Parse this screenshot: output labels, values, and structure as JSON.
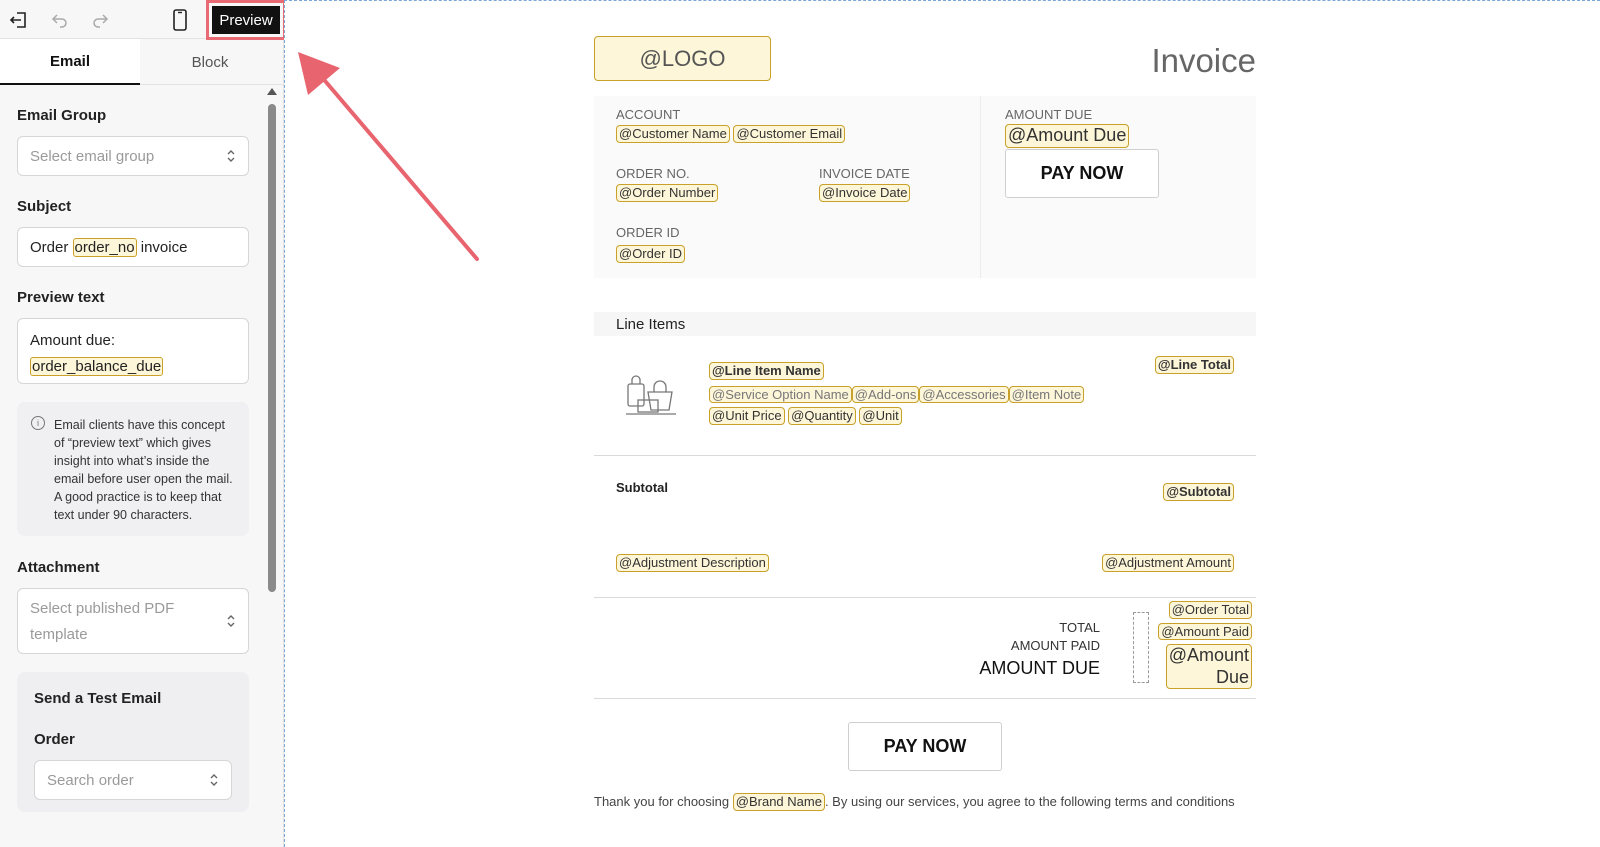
{
  "toolbar": {
    "preview_label": "Preview"
  },
  "tabs": [
    {
      "label": "Email",
      "active": true
    },
    {
      "label": "Block",
      "active": false
    }
  ],
  "panel": {
    "email_group": {
      "label": "Email Group",
      "placeholder": "Select email group"
    },
    "subject": {
      "label": "Subject",
      "prefix": "Order",
      "tag": "order_no",
      "suffix": "invoice"
    },
    "preview_text": {
      "label": "Preview text",
      "prefix": "Amount due:",
      "tag": "order_balance_due"
    },
    "info": "Email clients have this concept of “preview text” which gives insight into what’s inside the email before user open the mail. A good practice is to keep that text under 90 characters.",
    "attachment": {
      "label": "Attachment",
      "placeholder_line1": "Select published PDF",
      "placeholder_line2": "template"
    },
    "test_email": {
      "title": "Send a Test Email",
      "order_label": "Order",
      "order_placeholder": "Search order"
    }
  },
  "invoice": {
    "logo": "@LOGO",
    "title": "Invoice",
    "account": {
      "caption": "ACCOUNT",
      "name": "@Customer Name",
      "email": "@Customer Email"
    },
    "amount_due": {
      "caption": "AMOUNT DUE",
      "value": "@Amount Due"
    },
    "pay_now_top": "PAY NOW",
    "order_no": {
      "caption": "ORDER NO.",
      "value": "@Order Number"
    },
    "invoice_date": {
      "caption": "INVOICE DATE",
      "value": "@Invoice Date"
    },
    "order_id": {
      "caption": "ORDER ID",
      "value": "@Order ID"
    },
    "line_items": {
      "heading": "Line Items",
      "name": "@Line Item Name",
      "service_option": "@Service Option Name",
      "addons": "@Add-ons",
      "accessories": "@Accessories",
      "item_note": "@Item Note",
      "unit_price": "@Unit Price",
      "quantity": "@Quantity",
      "unit": "@Unit",
      "line_total": "@Line Total"
    },
    "subtotal": {
      "label": "Subtotal",
      "value": "@Subtotal"
    },
    "adjustment": {
      "description": "@Adjustment Description",
      "amount": "@Adjustment Amount"
    },
    "totals": {
      "total_label": "TOTAL",
      "amount_paid_label": "AMOUNT PAID",
      "amount_due_label": "AMOUNT DUE",
      "order_total": "@Order Total",
      "amount_paid": "@Amount Paid",
      "amount_due_line1": "@Amount",
      "amount_due_line2": "Due"
    },
    "pay_now_bottom": "PAY NOW",
    "footer": {
      "prefix": "Thank you for choosing",
      "brand": "@Brand Name",
      "suffix": ". By using our services, you agree to the following terms and conditions"
    }
  }
}
